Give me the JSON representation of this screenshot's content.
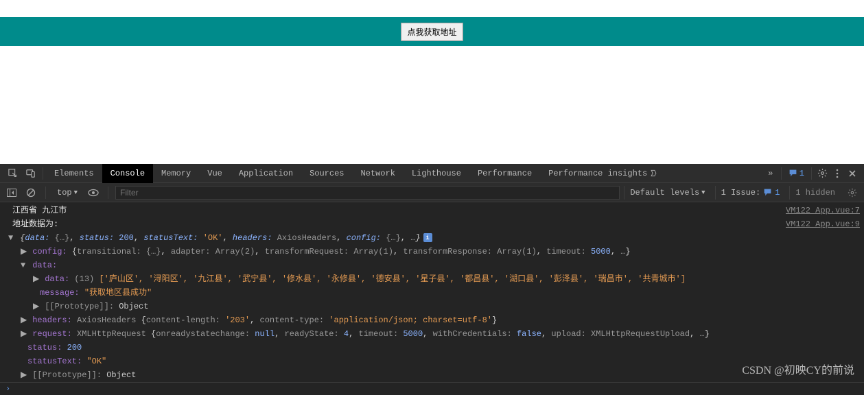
{
  "page": {
    "get_address_button": "点我获取地址"
  },
  "tabs": {
    "elements": "Elements",
    "console": "Console",
    "memory": "Memory",
    "vue": "Vue",
    "application": "Application",
    "sources": "Sources",
    "network": "Network",
    "lighthouse": "Lighthouse",
    "performance": "Performance",
    "performance_insights": "Performance insights"
  },
  "header": {
    "msg_count": "1"
  },
  "toolbar": {
    "context": "top",
    "filter_placeholder": "Filter",
    "levels": "Default levels",
    "issues_label": "1 Issue:",
    "issues_count": "1",
    "hidden": "1 hidden"
  },
  "logs": {
    "line1_text": "江西省 九江市",
    "line1_src": "VM122 App.vue:7",
    "line2_text": "地址数据为:",
    "line2_src": "VM122 App.vue:9",
    "summary": {
      "data_k": "data:",
      "data_v": "{…}",
      "status_k": "status:",
      "status_v": "200",
      "statusText_k": "statusText:",
      "statusText_v": "'OK'",
      "headers_k": "headers:",
      "headers_v": "AxiosHeaders",
      "config_k": "config:",
      "config_v": "{…}",
      "rest": "…"
    },
    "config": {
      "key": "config:",
      "transitional_k": "transitional:",
      "transitional_v": "{…}",
      "adapter_k": "adapter:",
      "adapter_v": "Array(2)",
      "transformRequest_k": "transformRequest:",
      "transformRequest_v": "Array(1)",
      "transformResponse_k": "transformResponse:",
      "transformResponse_v": "Array(1)",
      "timeout_k": "timeout:",
      "timeout_v": "5000",
      "rest": "…"
    },
    "data_outer": {
      "key": "data:"
    },
    "data_inner": {
      "key": "data:",
      "count": "(13)",
      "items": "['庐山区', '浔阳区', '九江县', '武宁县', '修水县', '永修县', '德安县', '星子县', '都昌县', '湖口县', '彭泽县', '瑞昌市', '共青城市']"
    },
    "message": {
      "key": "message:",
      "val": "\"获取地区县成功\""
    },
    "proto1": {
      "key": "[[Prototype]]:",
      "val": "Object"
    },
    "headers": {
      "key": "headers:",
      "cls": "AxiosHeaders",
      "cl_k": "content-length:",
      "cl_v": "'203'",
      "ct_k": "content-type:",
      "ct_v": "'application/json; charset=utf-8'"
    },
    "request": {
      "key": "request:",
      "cls": "XMLHttpRequest",
      "orsc_k": "onreadystatechange:",
      "orsc_v": "null",
      "rs_k": "readyState:",
      "rs_v": "4",
      "to_k": "timeout:",
      "to_v": "5000",
      "wc_k": "withCredentials:",
      "wc_v": "false",
      "up_k": "upload:",
      "up_v": "XMLHttpRequestUpload",
      "rest": "…"
    },
    "status": {
      "key": "status:",
      "val": "200"
    },
    "statusText": {
      "key": "statusText:",
      "val": "\"OK\""
    },
    "proto2": {
      "key": "[[Prototype]]:",
      "val": "Object"
    }
  },
  "watermark": "CSDN @初映CY的前说"
}
